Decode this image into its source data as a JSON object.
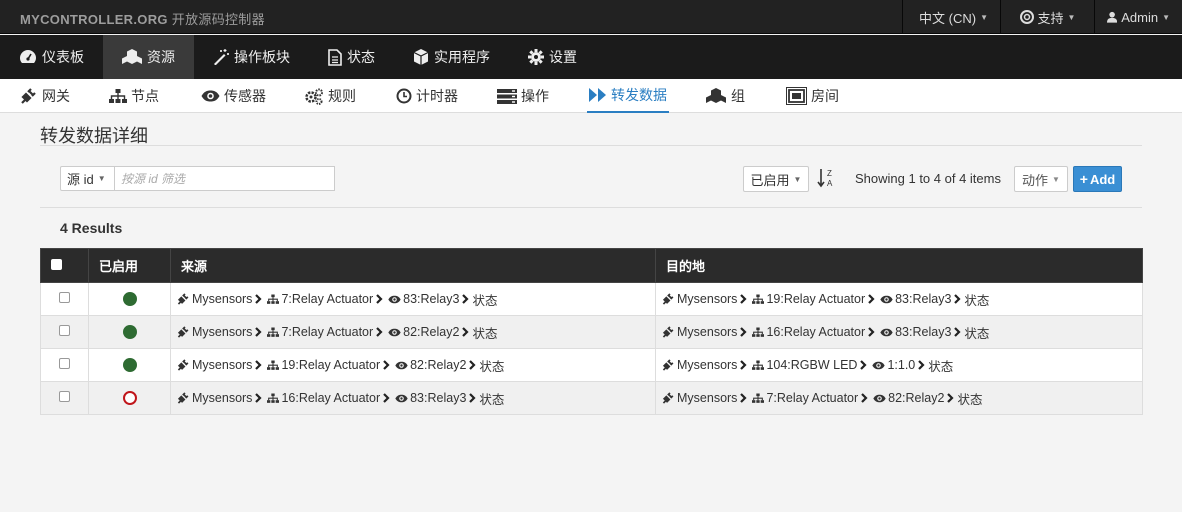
{
  "brand": {
    "name": "MYCONTROLLER.ORG",
    "subtitle": "开放源码控制器"
  },
  "topbar": {
    "language": "中文 (CN)",
    "support": "支持",
    "user": "Admin"
  },
  "main_nav": [
    {
      "label": "仪表板",
      "icon": "dashboard-icon"
    },
    {
      "label": "资源",
      "icon": "cubes-icon"
    },
    {
      "label": "操作板块",
      "icon": "magic-icon"
    },
    {
      "label": "状态",
      "icon": "file-icon"
    },
    {
      "label": "实用程序",
      "icon": "cube-icon"
    },
    {
      "label": "设置",
      "icon": "gear-icon"
    }
  ],
  "sub_nav": [
    {
      "label": "网关",
      "icon": "plug-icon"
    },
    {
      "label": "节点",
      "icon": "sitemap-icon"
    },
    {
      "label": "传感器",
      "icon": "eye-icon"
    },
    {
      "label": "规则",
      "icon": "cogs-icon"
    },
    {
      "label": "计时器",
      "icon": "clock-icon"
    },
    {
      "label": "操作",
      "icon": "server-icon"
    },
    {
      "label": "转发数据",
      "icon": "forward-icon"
    },
    {
      "label": "组",
      "icon": "cubes-icon"
    },
    {
      "label": "房间",
      "icon": "room-icon"
    }
  ],
  "page": {
    "title": "转发数据详细"
  },
  "filter": {
    "field": "源 id",
    "placeholder": "按源 id 筛选"
  },
  "toolbar": {
    "enabled_filter": "已启用",
    "showing": "Showing 1 to 4 of 4 items",
    "action": "动作",
    "add": "Add"
  },
  "results_label": "4 Results",
  "table": {
    "headers": {
      "enabled": "已启用",
      "source": "来源",
      "destination": "目的地"
    },
    "rows": [
      {
        "enabled": true,
        "source": {
          "gateway": "Mysensors",
          "node": "7:Relay Actuator",
          "sensor": "83:Relay3",
          "var": "状态"
        },
        "destination": {
          "gateway": "Mysensors",
          "node": "19:Relay Actuator",
          "sensor": "83:Relay3",
          "var": "状态"
        }
      },
      {
        "enabled": true,
        "source": {
          "gateway": "Mysensors",
          "node": "7:Relay Actuator",
          "sensor": "82:Relay2",
          "var": "状态"
        },
        "destination": {
          "gateway": "Mysensors",
          "node": "16:Relay Actuator",
          "sensor": "83:Relay3",
          "var": "状态"
        }
      },
      {
        "enabled": true,
        "source": {
          "gateway": "Mysensors",
          "node": "19:Relay Actuator",
          "sensor": "82:Relay2",
          "var": "状态"
        },
        "destination": {
          "gateway": "Mysensors",
          "node": "104:RGBW LED",
          "sensor": "1:1.0",
          "var": "状态"
        }
      },
      {
        "enabled": false,
        "source": {
          "gateway": "Mysensors",
          "node": "16:Relay Actuator",
          "sensor": "83:Relay3",
          "var": "状态"
        },
        "destination": {
          "gateway": "Mysensors",
          "node": "7:Relay Actuator",
          "sensor": "82:Relay2",
          "var": "状态"
        }
      }
    ]
  },
  "colors": {
    "enabled": "#2e6b32",
    "disabled": "#c0161b",
    "accent": "#2a7ec2",
    "add_button": "#3a8fd4"
  }
}
